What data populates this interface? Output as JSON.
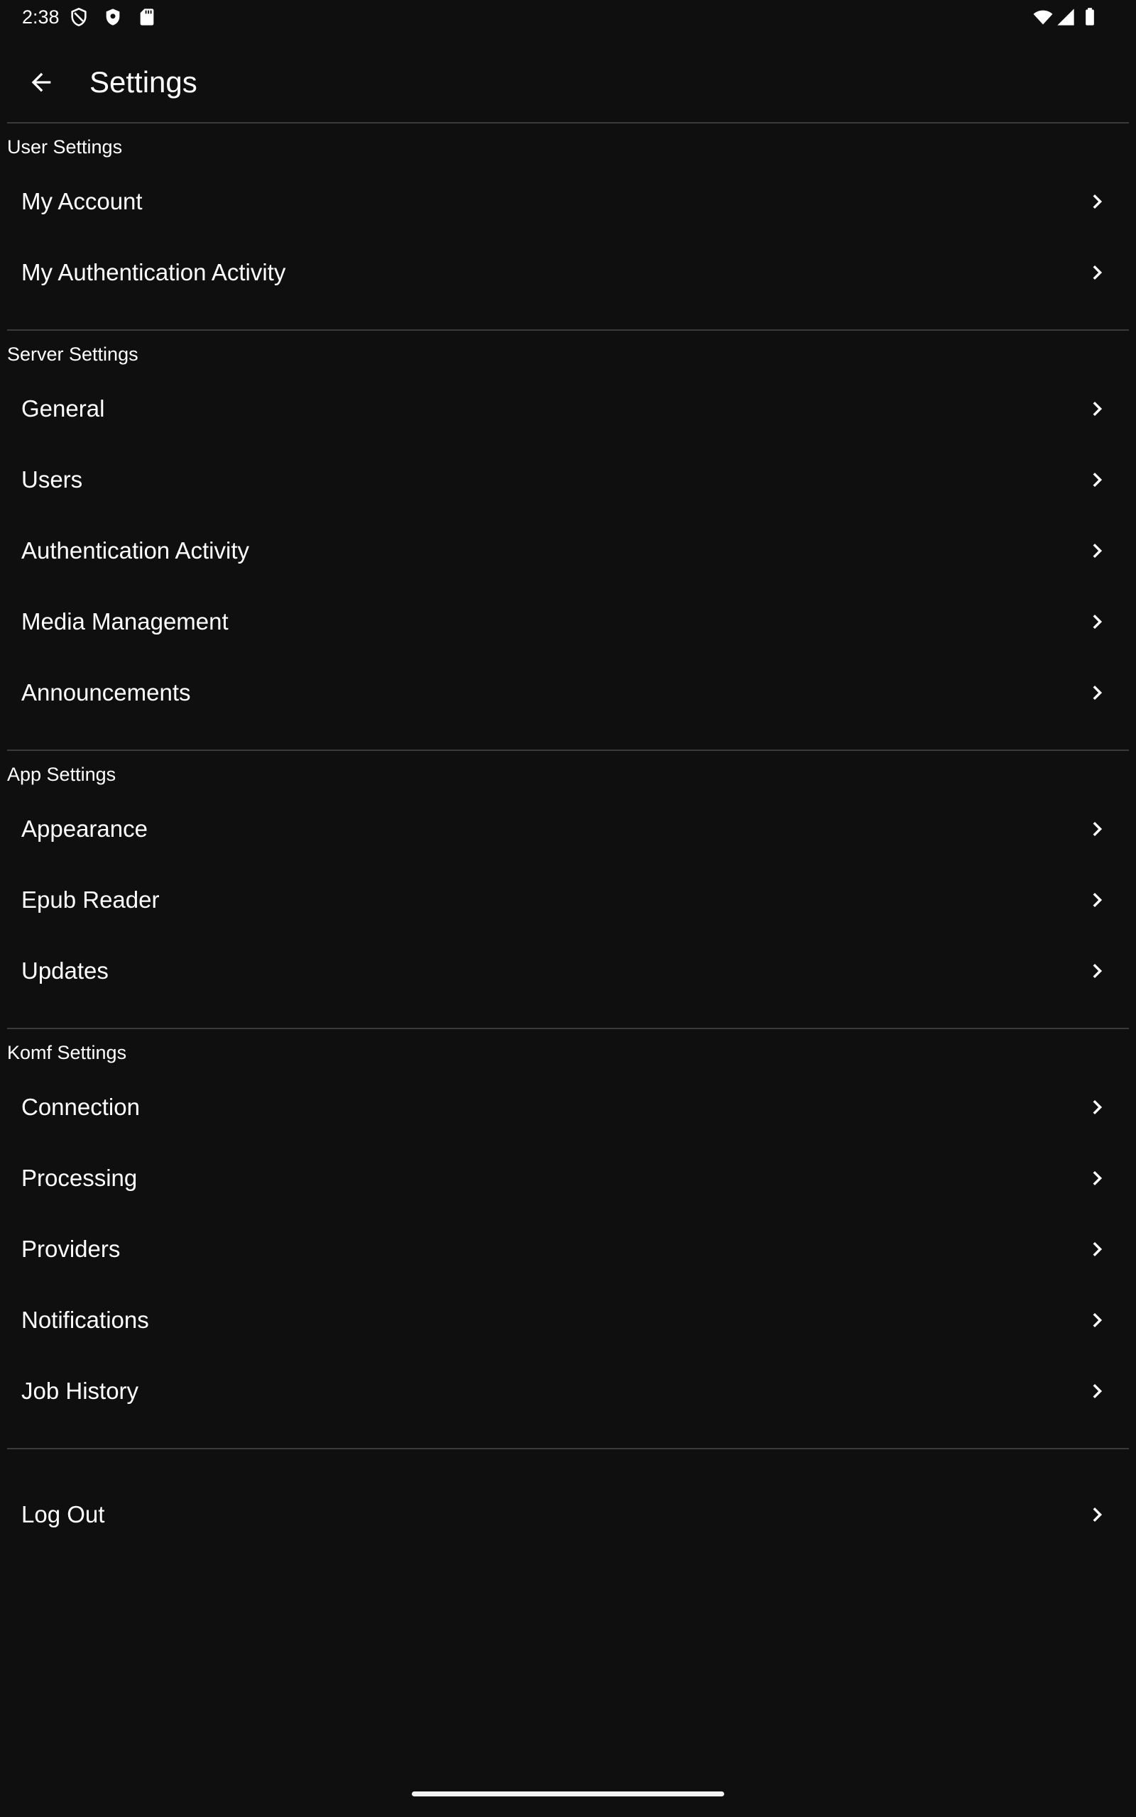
{
  "status_bar": {
    "time": "2:38",
    "left_icons": [
      "shield-outline-icon",
      "shield-filled-icon",
      "sd-card-icon"
    ],
    "right_icons": [
      "wifi-icon",
      "cellular-signal-icon",
      "battery-icon"
    ]
  },
  "app_bar": {
    "back_icon": "arrow-back-icon",
    "title": "Settings"
  },
  "sections": {
    "user": {
      "header": "User Settings",
      "items": [
        "My Account",
        "My Authentication Activity"
      ]
    },
    "server": {
      "header": "Server Settings",
      "items": [
        "General",
        "Users",
        "Authentication Activity",
        "Media Management",
        "Announcements"
      ]
    },
    "app": {
      "header": "App Settings",
      "items": [
        "Appearance",
        "Epub Reader",
        "Updates"
      ]
    },
    "komf": {
      "header": "Komf Settings",
      "items": [
        "Connection",
        "Processing",
        "Providers",
        "Notifications",
        "Job History"
      ]
    }
  },
  "logout": {
    "label": "Log Out"
  },
  "colors": {
    "background": "#0f0f0f",
    "text": "#ffffff",
    "divider": "#3a3a3a"
  },
  "item_icon": "chevron-right-icon"
}
